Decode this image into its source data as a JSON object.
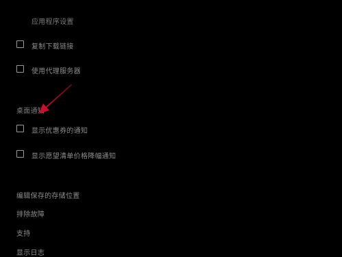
{
  "sections": {
    "app_settings": {
      "label": "应用程序设置"
    },
    "desktop_notifications": {
      "label": "桌面通知"
    }
  },
  "options": {
    "copy_download_link": {
      "label": "复制下载链接",
      "checked": false
    },
    "use_proxy_server": {
      "label": "使用代理服务器",
      "checked": false
    },
    "show_coupon_notifications": {
      "label": "显示优惠券的通知",
      "checked": false
    },
    "show_wishlist_price_drop": {
      "label": "显示愿望清单价格降幅通知",
      "checked": false
    }
  },
  "links": {
    "edit_storage_location": "编辑保存的存储位置",
    "troubleshoot": "排除故障",
    "support": "支持",
    "show_log": "显示日志"
  },
  "annotation": {
    "arrow_color": "#c8102e"
  }
}
